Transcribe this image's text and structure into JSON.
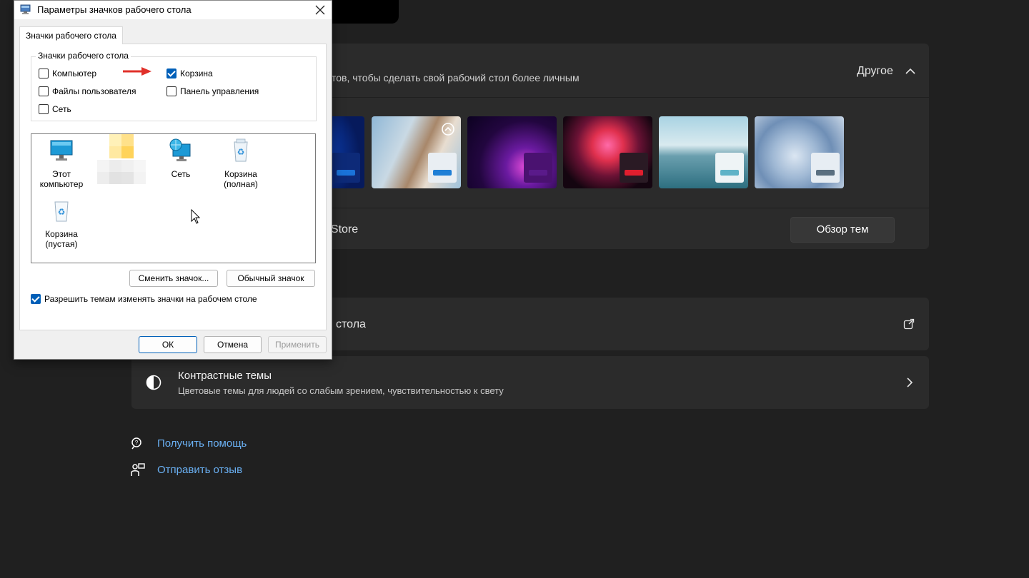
{
  "settings": {
    "themes_description": "тов, чтобы сделать свой рабочий стол более личным",
    "other_label": "Другое",
    "store_text": "t Store",
    "browse_button": "Обзор тем",
    "desktop_icons_label": "стола",
    "contrast_title": "Контрастные темы",
    "contrast_subtitle": "Цветовые темы для людей со слабым зрением, чувствительностью к свету",
    "get_help": "Получить помощь",
    "send_feedback": "Отправить отзыв",
    "theme_thumbnails": [
      {
        "name": "theme-blue-bloom",
        "accent": "#1a73d9"
      },
      {
        "name": "theme-flowers",
        "accent": "#1f7fd6"
      },
      {
        "name": "theme-glow",
        "accent": "#5a1a8a"
      },
      {
        "name": "theme-captured-motion",
        "accent": "#e01e2e"
      },
      {
        "name": "theme-sunrise-lake",
        "accent": "#5fb3c7"
      },
      {
        "name": "theme-flow",
        "accent": "#5a6f80"
      }
    ]
  },
  "dialog": {
    "title": "Параметры значков рабочего стола",
    "tab_label": "Значки рабочего стола",
    "group_label": "Значки рабочего стола",
    "checkboxes": {
      "computer": {
        "label": "Компьютер",
        "checked": false
      },
      "recycle_bin": {
        "label": "Корзина",
        "checked": true
      },
      "user_files": {
        "label": "Файлы пользователя",
        "checked": false
      },
      "control_panel": {
        "label": "Панель управления",
        "checked": false
      },
      "network": {
        "label": "Сеть",
        "checked": false
      }
    },
    "icons": {
      "this_pc": "Этот компьютер",
      "network": "Сеть",
      "bin_full": "Корзина (полная)",
      "bin_empty": "Корзина (пустая)"
    },
    "change_icon_button": "Сменить значок...",
    "default_icon_button": "Обычный значок",
    "allow_themes": {
      "label": "Разрешить темам изменять значки на рабочем столе",
      "checked": true
    },
    "ok_button": "ОК",
    "cancel_button": "Отмена",
    "apply_button": "Применить"
  }
}
